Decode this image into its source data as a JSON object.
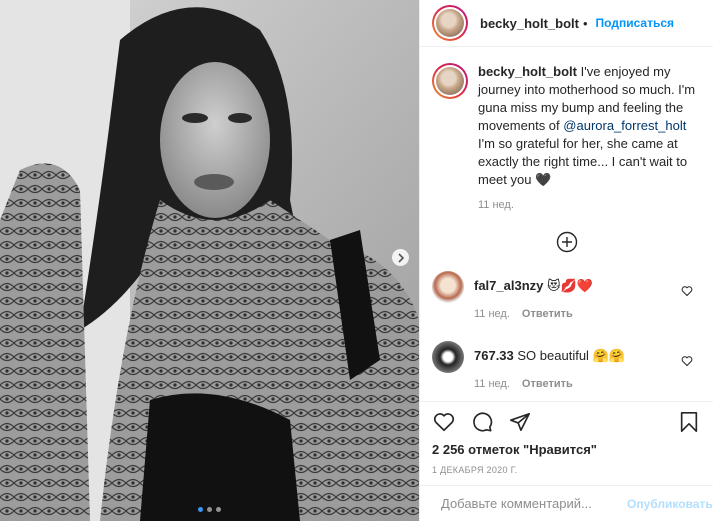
{
  "post": {
    "username": "becky_holt_bolt",
    "follow_label": "Подписаться",
    "caption_start": "I've enjoyed my journey into motherhood so much. I'm guna miss my bump and feeling the movements of",
    "mention": "@aurora_forrest_holt",
    "caption_end": "I'm so grateful for her, she came at exactly the right time... I can't wait to meet you 🖤",
    "caption_time": "11 нед."
  },
  "comments": [
    {
      "username": "fal7_al3nzy",
      "text": "😻💋❤️",
      "time": "11 нед.",
      "reply_label": "Ответить"
    },
    {
      "username": "767.33",
      "text": "SO beautiful 🤗🤗",
      "time": "11 нед.",
      "reply_label": "Ответить"
    }
  ],
  "footer": {
    "likes": "2 256 отметок \"Нравится\"",
    "date": "1 ДЕКАБРЯ 2020 Г.",
    "comment_placeholder": "Добавьте комментарий...",
    "publish_label": "Опубликовать"
  },
  "carousel": {
    "slides": 3,
    "active": 1
  },
  "colors": {
    "accent": "#0095f6",
    "muted": "#8e8e8e",
    "link": "#00376b"
  },
  "icons": [
    "chevron-right-icon",
    "add-circle-icon",
    "heart-icon",
    "comment-icon",
    "share-icon",
    "bookmark-icon",
    "emoji-icon"
  ]
}
